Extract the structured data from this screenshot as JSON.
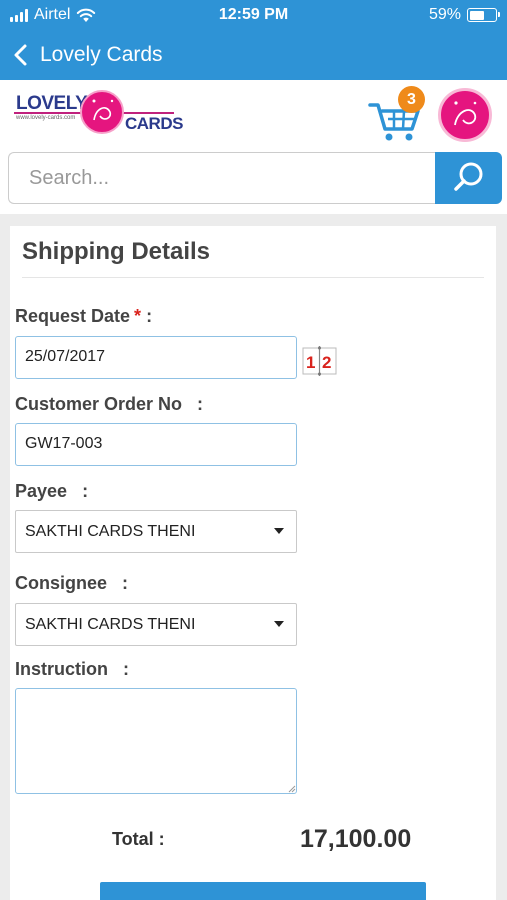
{
  "status_bar": {
    "carrier": "Airtel",
    "time": "12:59 PM",
    "battery": "59%",
    "battery_fraction": 0.59
  },
  "nav": {
    "title": "Lovely Cards",
    "back_icon": "chevron-left-icon"
  },
  "header": {
    "logo_word1": "LOVELY",
    "logo_tagline": "www.lovely-cards.com",
    "logo_word2": "CARDS",
    "cart_count": "3",
    "cart_icon": "cart-icon"
  },
  "search": {
    "placeholder": "Search...",
    "icon": "search-icon"
  },
  "form": {
    "title": "Shipping Details",
    "request_date": {
      "label": "Request Date",
      "required_mark": "*",
      "colon": ":",
      "value": "25/07/2017"
    },
    "calendar_icon_text": {
      "one": "1",
      "two": "2"
    },
    "customer_order": {
      "label": "Customer Order No",
      "colon": ":",
      "value": "GW17-003"
    },
    "payee": {
      "label": "Payee",
      "colon": ":",
      "value": "SAKTHI CARDS THENI"
    },
    "consignee": {
      "label": "Consignee",
      "colon": ":",
      "value": "SAKTHI CARDS THENI"
    },
    "instruction": {
      "label": "Instruction",
      "colon": ":",
      "value": ""
    }
  },
  "total": {
    "label": "Total :",
    "value": "17,100.00"
  },
  "colors": {
    "primary": "#2e93d6",
    "badge": "#ef8a1a",
    "brand_pink": "#e5157f",
    "brand_navy": "#2b3a8c",
    "required": "#d9231d"
  }
}
